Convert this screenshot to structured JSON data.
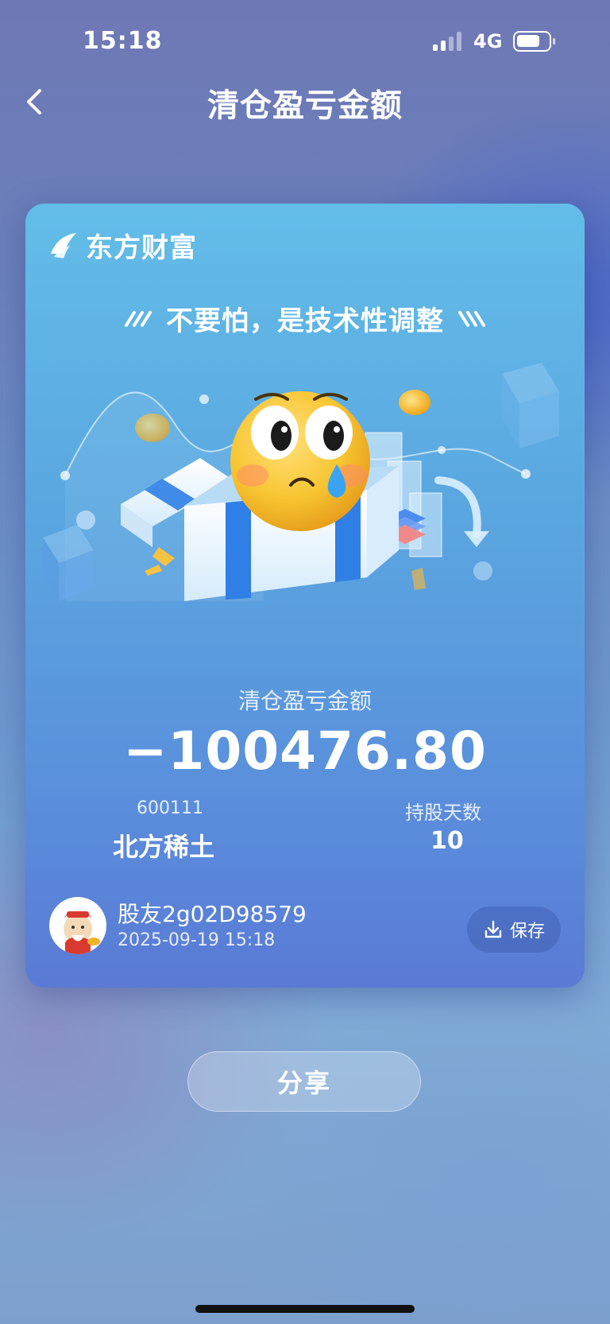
{
  "status_bar": {
    "time": "15:18",
    "network": "4G"
  },
  "nav": {
    "title": "清仓盈亏金额"
  },
  "card": {
    "brand_name": "东方财富",
    "slogan": "不要怕，是技术性调整",
    "label": "清仓盈亏金额",
    "amount": "−100476.80",
    "stock_code": "600111",
    "stock_name": "北方稀土",
    "holding_days_label": "持股天数",
    "holding_days_value": "10",
    "user_name": "股友2g02D98579",
    "timestamp": "2025-09-19 15:18",
    "save_label": "保存"
  },
  "share_label": "分享",
  "colors": {
    "card_top": "#63bde8",
    "card_bottom": "#5a7ad5",
    "emoji_face": "#f7c531",
    "tear": "#3aa4f2"
  },
  "icons": [
    "back-chevron-icon",
    "eastmoney-logo-icon",
    "download-icon",
    "signal-icon",
    "battery-icon"
  ]
}
